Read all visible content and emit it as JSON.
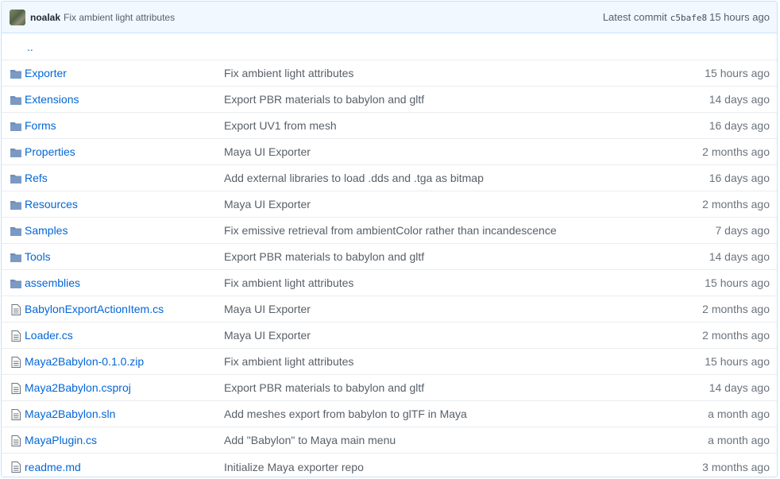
{
  "commit": {
    "author": "noalak",
    "message": "Fix ambient light attributes",
    "latest_label": "Latest commit",
    "sha": "c5bafe8",
    "age": "15 hours ago"
  },
  "parent_link": "..",
  "colors": {
    "link": "#0366d6",
    "folder_icon": "#79b8ff",
    "file_icon": "#6a737d",
    "header_bg": "#f1f8ff"
  },
  "files": [
    {
      "type": "folder",
      "icon": "folder-icon",
      "name": "Exporter",
      "message": "Fix ambient light attributes",
      "age": "15 hours ago"
    },
    {
      "type": "folder",
      "icon": "folder-icon",
      "name": "Extensions",
      "message": "Export PBR materials to babylon and gltf",
      "age": "14 days ago"
    },
    {
      "type": "folder",
      "icon": "folder-icon",
      "name": "Forms",
      "message": "Export UV1 from mesh",
      "age": "16 days ago"
    },
    {
      "type": "folder",
      "icon": "folder-icon",
      "name": "Properties",
      "message": "Maya UI Exporter",
      "age": "2 months ago"
    },
    {
      "type": "folder",
      "icon": "folder-icon",
      "name": "Refs",
      "message": "Add external libraries to load .dds and .tga as bitmap",
      "age": "16 days ago"
    },
    {
      "type": "folder",
      "icon": "folder-icon",
      "name": "Resources",
      "message": "Maya UI Exporter",
      "age": "2 months ago"
    },
    {
      "type": "folder",
      "icon": "folder-icon",
      "name": "Samples",
      "message": "Fix emissive retrieval from ambientColor rather than incandescence",
      "age": "7 days ago"
    },
    {
      "type": "folder",
      "icon": "folder-icon",
      "name": "Tools",
      "message": "Export PBR materials to babylon and gltf",
      "age": "14 days ago"
    },
    {
      "type": "folder",
      "icon": "folder-icon",
      "name": "assemblies",
      "message": "Fix ambient light attributes",
      "age": "15 hours ago"
    },
    {
      "type": "file",
      "icon": "file-icon",
      "name": "BabylonExportActionItem.cs",
      "message": "Maya UI Exporter",
      "age": "2 months ago"
    },
    {
      "type": "file",
      "icon": "file-icon",
      "name": "Loader.cs",
      "message": "Maya UI Exporter",
      "age": "2 months ago"
    },
    {
      "type": "file",
      "icon": "file-icon",
      "name": "Maya2Babylon-0.1.0.zip",
      "message": "Fix ambient light attributes",
      "age": "15 hours ago"
    },
    {
      "type": "file",
      "icon": "file-icon",
      "name": "Maya2Babylon.csproj",
      "message": "Export PBR materials to babylon and gltf",
      "age": "14 days ago"
    },
    {
      "type": "file",
      "icon": "file-icon",
      "name": "Maya2Babylon.sln",
      "message": "Add meshes export from babylon to glTF in Maya",
      "age": "a month ago"
    },
    {
      "type": "file",
      "icon": "file-icon",
      "name": "MayaPlugin.cs",
      "message": "Add \"Babylon\" to Maya main menu",
      "age": "a month ago"
    },
    {
      "type": "file",
      "icon": "file-icon",
      "name": "readme.md",
      "message": "Initialize Maya exporter repo",
      "age": "3 months ago"
    }
  ]
}
